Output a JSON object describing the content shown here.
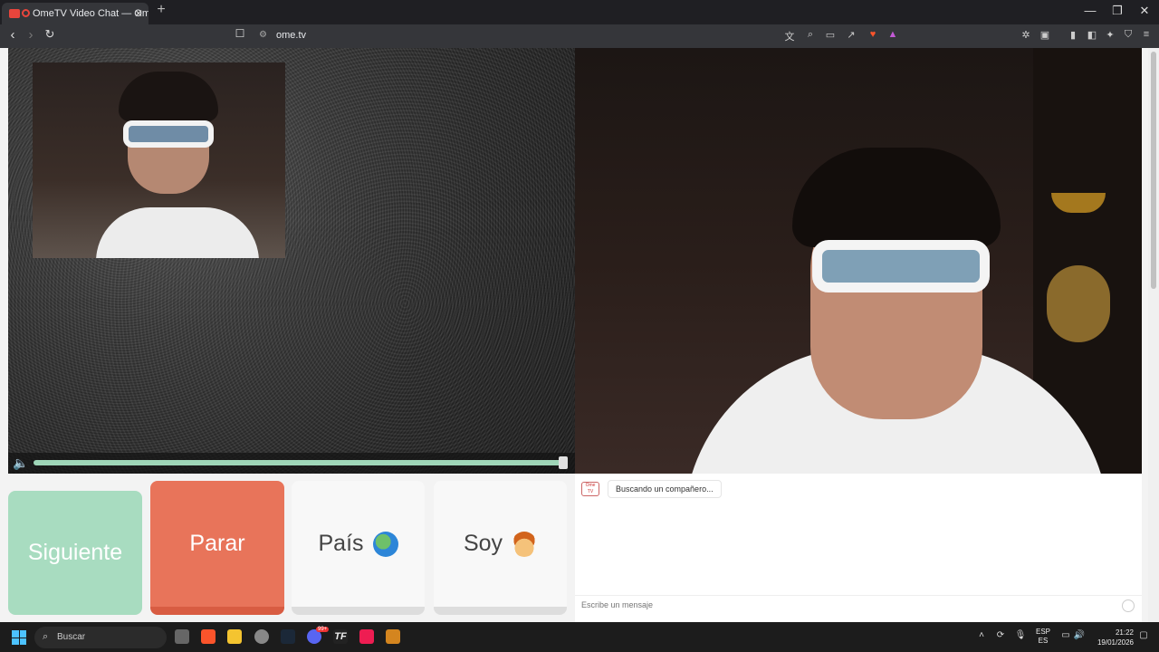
{
  "browser": {
    "tab_title": "OmeTV Video Chat — Omeg",
    "tab_close": "✕",
    "new_tab": "+",
    "url": "ome.tv"
  },
  "buttons": {
    "next": "Siguiente",
    "stop": "Parar",
    "country": "País",
    "gender": "Soy"
  },
  "chat": {
    "logo": "Ome TV",
    "status_message": "Buscando un compañero...",
    "input_placeholder": "Escribe un mensaje"
  },
  "player": {
    "volume_level": 1.0
  },
  "taskbar": {
    "search_label": "Buscar",
    "discord_badge": "99+",
    "language_top": "ESP",
    "language_bottom": "ES",
    "time": "21:22",
    "date": "19/01/2026"
  },
  "colors": {
    "next_button": "#a8dcc0",
    "stop_button": "#e8745a",
    "volume_track": "#9fd6b8"
  }
}
